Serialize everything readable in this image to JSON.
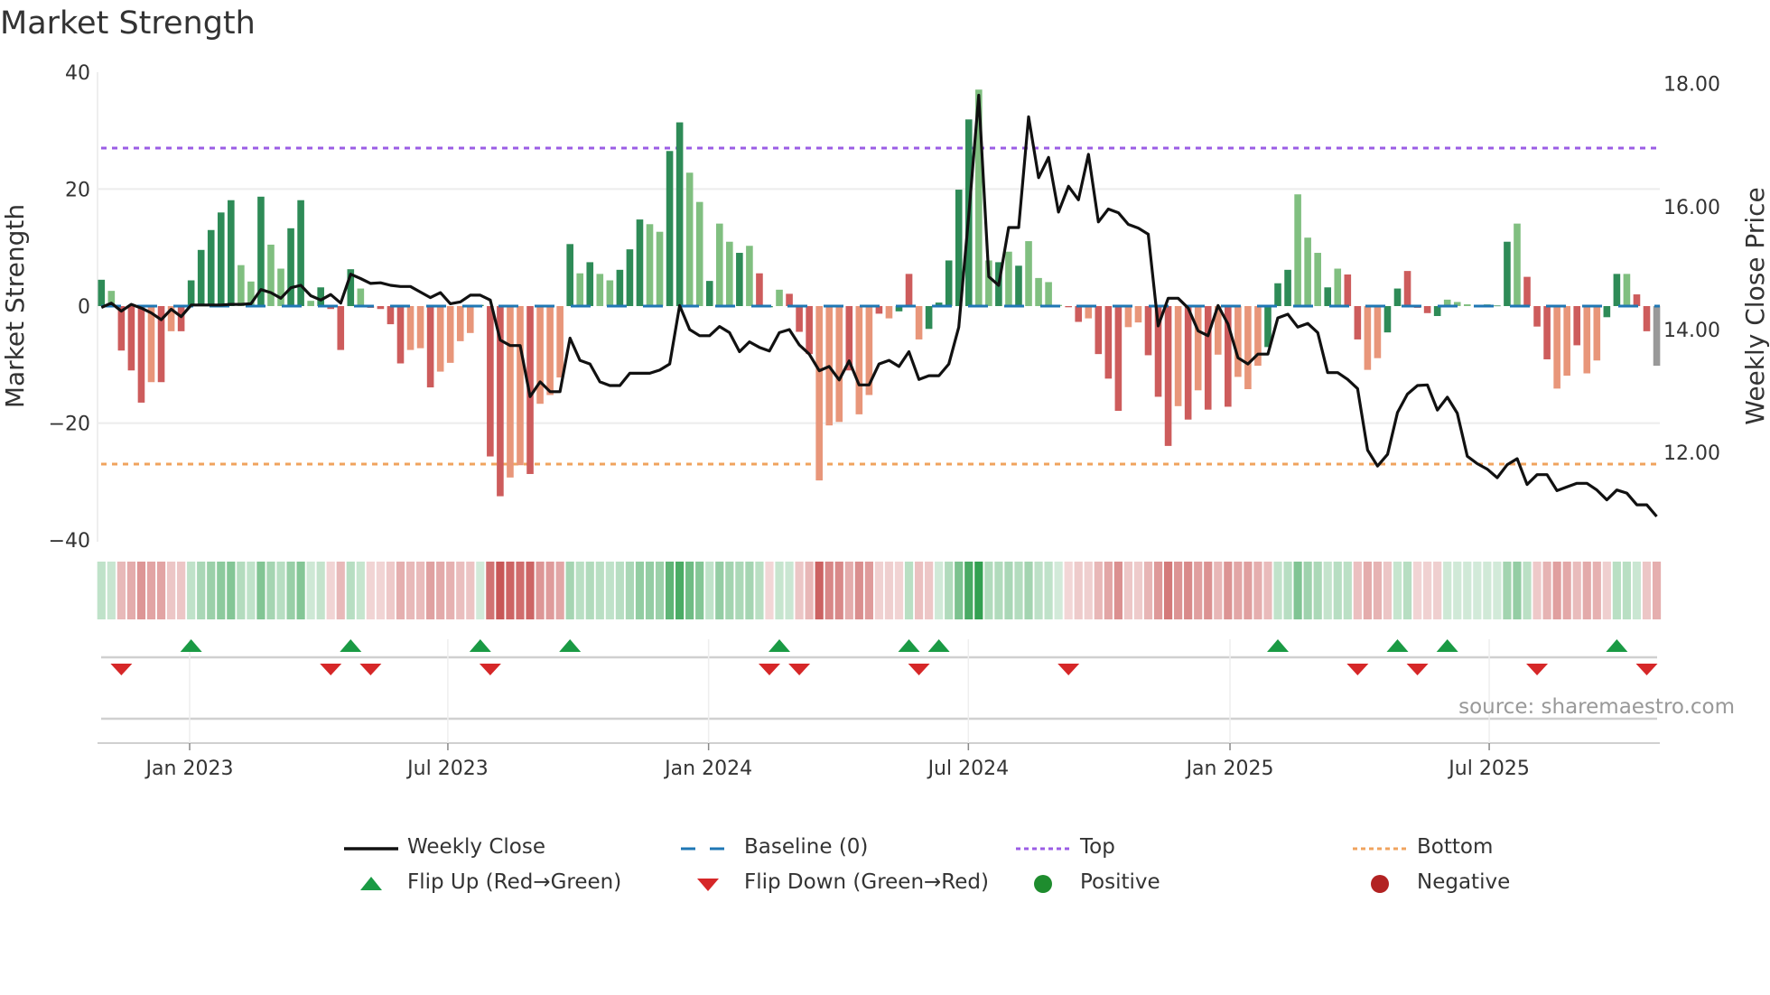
{
  "chart_data": {
    "type": "bar",
    "title": "Market Strength",
    "ylabel": "Market Strength",
    "y2label": "Weekly Close Price",
    "ylim": [
      -40,
      40
    ],
    "y2lim": [
      10.6,
      18.2
    ],
    "yticks": [
      "40",
      "20",
      "0",
      "−20",
      "−40"
    ],
    "ytick_values": [
      40,
      20,
      0,
      -20,
      -40
    ],
    "y2ticks": [
      "18.00",
      "16.00",
      "14.00",
      "12.00"
    ],
    "y2tick_values": [
      18,
      16,
      14,
      12
    ],
    "xticks": [
      {
        "label": "Jan 2023",
        "week": 8.85
      },
      {
        "label": "Jul 2023",
        "week": 34.75
      },
      {
        "label": "Jan 2024",
        "week": 60.9
      },
      {
        "label": "Jul 2024",
        "week": 86.96
      },
      {
        "label": "Jan 2025",
        "week": 113.2
      },
      {
        "label": "Jul 2025",
        "week": 139.2
      }
    ],
    "top_level": 27,
    "bottom_level": -27,
    "baseline": 0,
    "strength": [
      4.5,
      2.6,
      -7.6,
      -11,
      -16.5,
      -13,
      -13,
      -4.3,
      -4.3,
      4.4,
      9.6,
      13,
      16,
      18.1,
      7,
      4.2,
      18.7,
      10.5,
      6.4,
      13.3,
      18.1,
      0.9,
      3.2,
      -0.5,
      -7.5,
      6.3,
      3,
      -0.3,
      -0.5,
      -3.1,
      -9.8,
      -7.5,
      -7.2,
      -13.9,
      -11.2,
      -9.7,
      -6,
      -4.6,
      0.2,
      -25.7,
      -32.5,
      -29.3,
      -27.2,
      -28.7,
      -16.7,
      -15.2,
      -12.2,
      10.6,
      5.6,
      7.5,
      5.5,
      4.4,
      6.2,
      9.7,
      14.8,
      14,
      12.7,
      26.5,
      31.4,
      22.8,
      17.8,
      4.3,
      14.1,
      11,
      9.1,
      10.3,
      5.6,
      -0.2,
      2.8,
      2.1,
      -4.4,
      -8.2,
      -29.8,
      -20.4,
      -19.8,
      -11,
      -18.5,
      -15.2,
      -1.3,
      -2.1,
      -0.9,
      5.5,
      -5.7,
      -3.9,
      0.6,
      7.8,
      19.9,
      31.9,
      37,
      7.8,
      7.5,
      9.3,
      6.9,
      11.1,
      4.8,
      4.1,
      0.2,
      -0.2,
      -2.7,
      -2.1,
      -8.2,
      -12.4,
      -17.9,
      -3.6,
      -2.8,
      -8.4,
      -15.5,
      -23.9,
      -17.1,
      -19.4,
      -14.4,
      -17.7,
      -8.3,
      -17.2,
      -12.1,
      -14.2,
      -10.2,
      -7,
      3.9,
      6.2,
      19.1,
      11.7,
      9.1,
      3.2,
      6.4,
      5.4,
      -5.7,
      -10.9,
      -8.9,
      -4.5,
      3,
      6,
      -0.3,
      -1.2,
      -1.7,
      1.1,
      0.7,
      0.3,
      0.05,
      0.3,
      0.1,
      11,
      14.1,
      5,
      -3.5,
      -9.1,
      -14.1,
      -11.9,
      -6.7,
      -11.5,
      -9.3,
      -1.9,
      5.5,
      5.5,
      2,
      -4.3,
      -10.2
    ],
    "shade": "GgRRRrRrRGGGGGggGggGGgGRRGgRRRRrrRrrrrGRRrrRrrrGgGggGGGggGGggGggGgRGgRRRrrrRrrRrGRrGGGGGggGgGggggRRrRRRrrRRRrRrRrRrrrGGGgggGgRRrrGGRRRGgggGgGGgRRRrrRrrGGgRR",
    "weekly_close": [
      14.36,
      14.43,
      14.3,
      14.41,
      14.35,
      14.27,
      14.16,
      14.33,
      14.21,
      14.4,
      14.4,
      14.4,
      14.4,
      14.41,
      14.41,
      14.42,
      14.65,
      14.6,
      14.51,
      14.68,
      14.72,
      14.55,
      14.48,
      14.57,
      14.43,
      14.9,
      14.83,
      14.75,
      14.76,
      14.72,
      14.7,
      14.7,
      14.61,
      14.52,
      14.6,
      14.42,
      14.45,
      14.56,
      14.56,
      14.48,
      13.83,
      13.74,
      13.74,
      12.91,
      13.15,
      12.99,
      12.99,
      13.86,
      13.5,
      13.44,
      13.15,
      13.09,
      13.09,
      13.29,
      13.29,
      13.29,
      13.34,
      13.44,
      14.39,
      14.0,
      13.9,
      13.9,
      14.05,
      13.95,
      13.64,
      13.8,
      13.71,
      13.65,
      13.95,
      14.0,
      13.75,
      13.6,
      13.33,
      13.4,
      13.18,
      13.49,
      13.1,
      13.1,
      13.44,
      13.5,
      13.4,
      13.64,
      13.19,
      13.25,
      13.25,
      13.44,
      14.04,
      15.87,
      17.81,
      14.86,
      14.72,
      15.66,
      15.66,
      17.46,
      16.47,
      16.8,
      15.91,
      16.33,
      16.11,
      16.85,
      15.75,
      15.96,
      15.9,
      15.71,
      15.65,
      15.55,
      14.06,
      14.51,
      14.51,
      14.35,
      13.98,
      13.9,
      14.39,
      14.09,
      13.54,
      13.44,
      13.6,
      13.6,
      14.19,
      14.25,
      14.04,
      14.1,
      13.95,
      13.3,
      13.3,
      13.19,
      13.04,
      12.04,
      11.78,
      11.97,
      12.65,
      12.95,
      13.09,
      13.1,
      12.69,
      12.9,
      12.64,
      11.94,
      11.82,
      11.73,
      11.59,
      11.8,
      11.9,
      11.48,
      11.64,
      11.64,
      11.38,
      11.44,
      11.5,
      11.5,
      11.39,
      11.23,
      11.39,
      11.34,
      11.15,
      11.15,
      10.96
    ],
    "flip_up_weeks": [
      9,
      25,
      38,
      47,
      68,
      81,
      84,
      118,
      130,
      135,
      152
    ],
    "flip_down_weeks": [
      2,
      23,
      27,
      39,
      67,
      70,
      82,
      97,
      126,
      132,
      144,
      155
    ],
    "colors": {
      "strong_positive": "#2e8b57",
      "weak_positive": "#80bf80",
      "strong_negative": "#cd5c5c",
      "weak_negative": "#e8967a",
      "close_line": "#111111",
      "baseline": "#1f77b4",
      "top": "#9b5de5",
      "bottom": "#f0a35e",
      "flip_up": "#1a9a44",
      "flip_down": "#d62728",
      "positive": "#1e8c2e",
      "negative": "#b22222"
    },
    "legend": [
      {
        "label": "Weekly Close",
        "kind": "line"
      },
      {
        "label": "Baseline (0)",
        "kind": "dash"
      },
      {
        "label": "Top",
        "kind": "dot-purple"
      },
      {
        "label": "Bottom",
        "kind": "dot-orange"
      },
      {
        "label": "Flip Up (Red→Green)",
        "kind": "tri-up"
      },
      {
        "label": "Flip Down (Green→Red)",
        "kind": "tri-down"
      },
      {
        "label": "Positive",
        "kind": "dot-green"
      },
      {
        "label": "Negative",
        "kind": "dot-red"
      }
    ],
    "legend_placement": "bottom"
  },
  "source": "source: sharemaestro.com"
}
